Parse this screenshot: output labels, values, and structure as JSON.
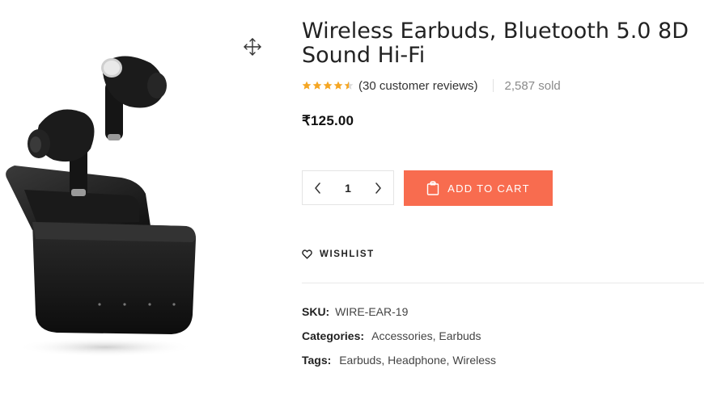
{
  "product": {
    "title_line1": "Wireless Earbuds, Bluetooth 5.0 8D",
    "title_line2": "Sound Hi-Fi",
    "rating": 4.5,
    "rating_max": 5,
    "reviews_text": "(30 customer reviews)",
    "sold_text": "2,587 sold",
    "price": "₹125.00",
    "quantity": "1",
    "add_to_cart_label": "Add to cart",
    "wishlist_label": "Wishlist"
  },
  "meta": {
    "sku_label": "SKU:",
    "sku_value": "WIRE-EAR-19",
    "categories_label": "Categories:",
    "categories": [
      "Accessories",
      "Earbuds"
    ],
    "tags_label": "Tags:",
    "tags": [
      "Earbuds",
      "Headphone",
      "Wireless"
    ]
  },
  "icons": {
    "move": "move-arrows-icon",
    "star": "star-icon",
    "decrease": "chevron-left-icon",
    "increase": "chevron-right-icon",
    "cart": "shopping-bag-icon",
    "wishlist": "heart-outline-icon"
  },
  "colors": {
    "accent": "#f86c4f",
    "star": "#f5a623",
    "text": "#222222",
    "muted": "#8a8a8a"
  }
}
